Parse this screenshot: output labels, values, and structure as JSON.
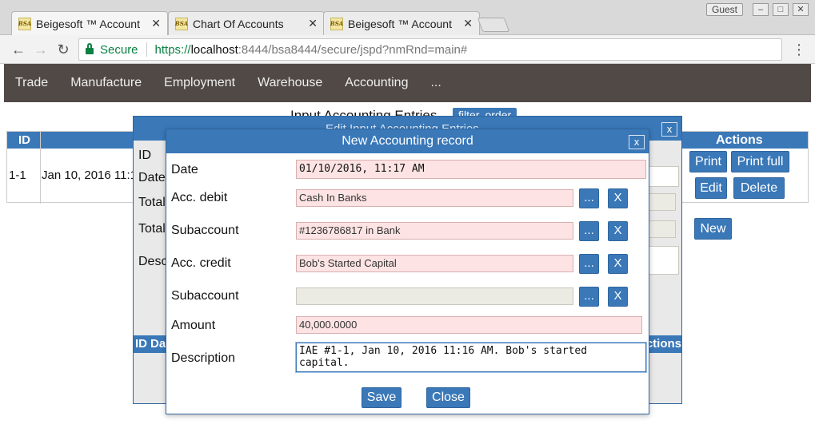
{
  "browser": {
    "tabs": [
      {
        "favicon": "BSA",
        "title": "Beigesoft ™ Account",
        "active": true
      },
      {
        "favicon": "BSA",
        "title": "Chart Of Accounts",
        "active": false
      },
      {
        "favicon": "BSA",
        "title": "Beigesoft ™ Account",
        "active": false
      }
    ],
    "guest_label": "Guest",
    "secure_label": "Secure",
    "url": {
      "scheme": "https://",
      "host": "localhost",
      "rest": ":8444/bsa8444/secure/jspd?nmRnd=main#"
    }
  },
  "nav": {
    "items": [
      "Trade",
      "Manufacture",
      "Employment",
      "Warehouse",
      "Accounting",
      "..."
    ]
  },
  "page": {
    "title": "Input Accounting Entries",
    "filter_order": "filter, order"
  },
  "table": {
    "headers": {
      "id": "ID",
      "actions": "Actions"
    },
    "row": {
      "id": "1-1",
      "date": "Jan 10, 2016 11:16"
    },
    "buttons": {
      "print": "Print",
      "print_full": "Print full",
      "edit": "Edit",
      "delete": "Delete",
      "new": "New"
    }
  },
  "edit_dialog": {
    "title": "Edit Input Accounting Entries",
    "close": "x",
    "labels": {
      "id": "ID",
      "date": "Date",
      "total1": "Total",
      "total2": "Total",
      "desc": "Desc"
    },
    "table_headers": {
      "id": "ID",
      "da": "Da",
      "actions": "Actions"
    }
  },
  "record_dialog": {
    "title": "New Accounting record",
    "close": "x",
    "labels": {
      "date": "Date",
      "acc_debit": "Acc. debit",
      "subaccount_debit": "Subaccount",
      "acc_credit": "Acc. credit",
      "subaccount_credit": "Subaccount",
      "amount": "Amount",
      "description": "Description"
    },
    "values": {
      "date": "01/10/2016, 11:17 AM",
      "acc_debit": "Cash In Banks",
      "subaccount_debit": "#1236786817 in Bank",
      "acc_credit": "Bob's Started Capital",
      "subaccount_credit": "",
      "amount": "40,000.0000",
      "description": "IAE #1-1, Jan 10, 2016 11:16 AM. Bob's started capital."
    },
    "pick_label": "...",
    "clear_label": "X",
    "save": "Save",
    "close_button": "Close"
  },
  "colors": {
    "accent": "#3a78b8",
    "nav_bg": "#504945",
    "required_bg": "#fde3e3"
  }
}
